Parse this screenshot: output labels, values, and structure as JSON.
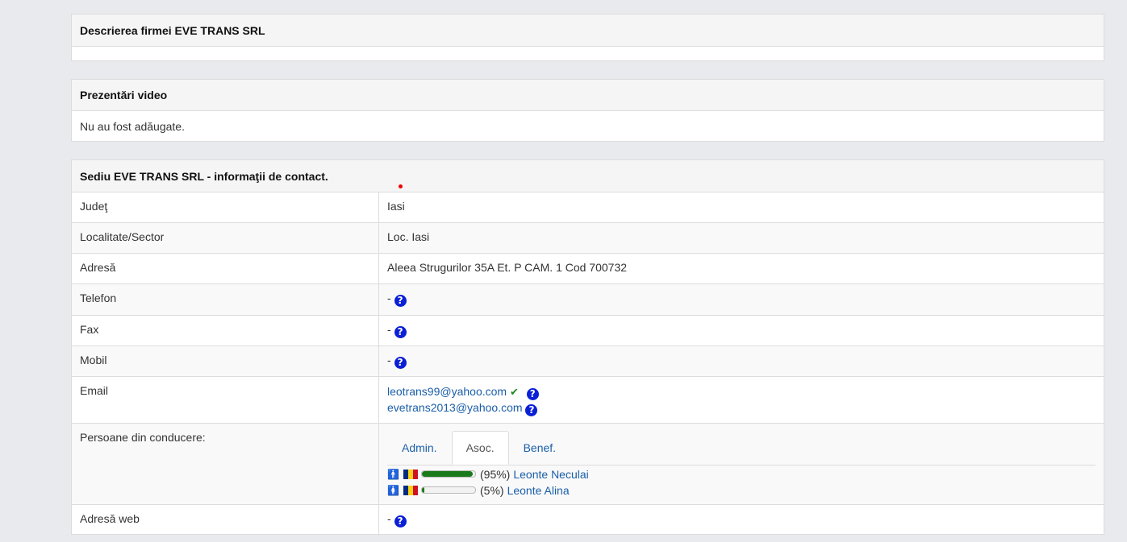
{
  "description_panel": {
    "title": "Descrierea firmei EVE TRANS SRL"
  },
  "video_panel": {
    "title": "Prezentări video",
    "body": "Nu au fost adăugate."
  },
  "contact_panel": {
    "title": "Sediu EVE TRANS SRL - informaţii de contact.",
    "county_label": "Judeţ",
    "county_value": "Iasi",
    "locality_label": "Localitate/Sector",
    "locality_value": "Loc. Iasi",
    "address_label": "Adresă",
    "address_value": "Aleea Strugurilor 35A Et. P CAM. 1 Cod 700732",
    "phone_label": "Telefon",
    "phone_value": "-",
    "fax_label": "Fax",
    "fax_value": "-",
    "mobile_label": "Mobil",
    "mobile_value": "-",
    "email_label": "Email",
    "emails": [
      "leotrans99@yahoo.com",
      "evetrans2013@yahoo.com"
    ],
    "management_label": "Persoane din conducere:",
    "tabs": [
      "Admin.",
      "Asoc.",
      "Benef."
    ],
    "active_tab": "Asoc.",
    "persons": [
      {
        "name": "Leonte Neculai",
        "share_text": "(95%)",
        "share": 95,
        "gender_icon": "male-person-icon"
      },
      {
        "name": "Leonte Alina",
        "share_text": "(5%)",
        "share": 5,
        "gender_icon": "female-person-icon"
      }
    ],
    "web_label": "Adresă web",
    "web_value": "-"
  },
  "icons": {
    "help": "?",
    "check": "✔",
    "male": "🚹",
    "female": "🚺"
  },
  "colors": {
    "help_icon": "#0a1fd6",
    "link": "#1a5ea8",
    "check": "#1b8a1b",
    "share_bar": "#1b7a1b",
    "flag": [
      "#002b7f",
      "#fcd116",
      "#ce1126"
    ]
  }
}
